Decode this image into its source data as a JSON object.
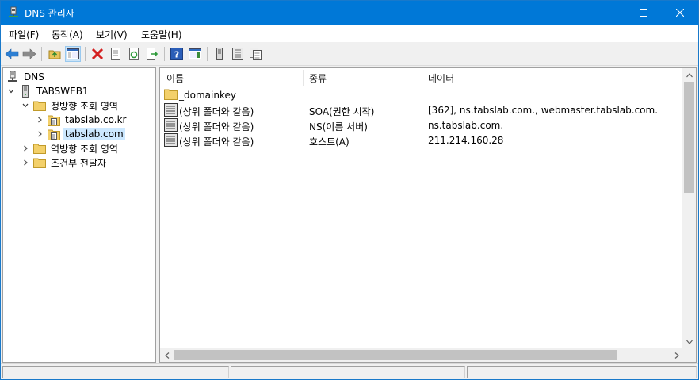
{
  "window": {
    "title": "DNS 관리자",
    "icon": "dns-server-icon",
    "controls": [
      "minimize-icon",
      "maximize-icon",
      "close-icon"
    ]
  },
  "menu": {
    "items": [
      {
        "label": "파일(F)"
      },
      {
        "label": "동작(A)"
      },
      {
        "label": "보기(V)"
      },
      {
        "label": "도움말(H)"
      }
    ]
  },
  "toolbar": {
    "buttons": [
      "back-arrow-icon",
      "forward-arrow-icon",
      "up-folder-icon",
      "show-hide-tree-icon",
      "delete-icon",
      "properties-icon",
      "refresh-icon",
      "export-list-icon",
      "help-icon",
      "show-hide-action-pane-icon",
      "server-icon",
      "zone-records-icon",
      "copy-records-icon"
    ],
    "active_button": "show-hide-tree-icon"
  },
  "tree": {
    "items": [
      {
        "label": "DNS",
        "icon": "dns-root-icon",
        "level": 0,
        "expander": "none"
      },
      {
        "label": "TABSWEB1",
        "icon": "server-icon",
        "level": 1,
        "expander": "expanded"
      },
      {
        "label": "정방향 조회 영역",
        "icon": "folder-icon",
        "level": 2,
        "expander": "expanded"
      },
      {
        "label": "tabslab.co.kr",
        "icon": "zone-icon",
        "level": 3,
        "expander": "collapsed"
      },
      {
        "label": "tabslab.com",
        "icon": "zone-icon",
        "level": 3,
        "expander": "collapsed",
        "selected": true
      },
      {
        "label": "역방향 조회 영역",
        "icon": "folder-icon",
        "level": 2,
        "expander": "collapsed"
      },
      {
        "label": "조건부 전달자",
        "icon": "folder-icon",
        "level": 2,
        "expander": "collapsed"
      }
    ]
  },
  "list": {
    "columns": [
      "이름",
      "종류",
      "데이터"
    ],
    "rows": [
      {
        "name": "_domainkey",
        "type": "",
        "data": "",
        "icon": "folder-icon"
      },
      {
        "name": "(상위 폴더와 같음)",
        "type": "SOA(권한 시작)",
        "data": "[362], ns.tabslab.com., webmaster.tabslab.com.",
        "icon": "record-icon"
      },
      {
        "name": "(상위 폴더와 같음)",
        "type": "NS(이름 서버)",
        "data": "ns.tabslab.com.",
        "icon": "record-icon"
      },
      {
        "name": "(상위 폴더와 같음)",
        "type": "호스트(A)",
        "data": "211.214.160.28",
        "icon": "record-icon"
      }
    ]
  },
  "colors": {
    "titlebar": "#0078d7",
    "selection": "#cce8ff",
    "delete_icon": "#d42020",
    "help_icon": "#2b5eb8"
  }
}
